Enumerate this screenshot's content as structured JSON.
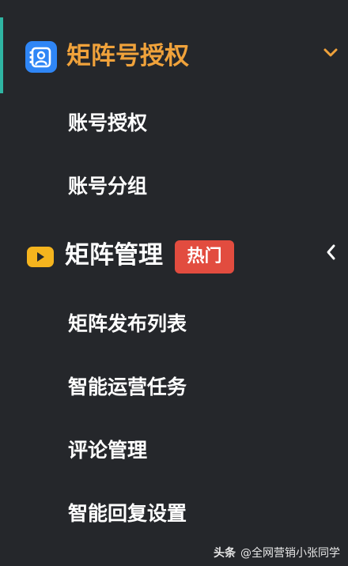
{
  "sidebar": {
    "sections": [
      {
        "title": "矩阵号授权",
        "icon": "user-card-icon",
        "expanded": true,
        "items": [
          {
            "label": "账号授权"
          },
          {
            "label": "账号分组"
          }
        ]
      },
      {
        "title": "矩阵管理",
        "icon": "video-icon",
        "badge": "热门",
        "expanded": false,
        "items": [
          {
            "label": "矩阵发布列表"
          },
          {
            "label": "智能运营任务"
          },
          {
            "label": "评论管理"
          },
          {
            "label": "智能回复设置"
          }
        ]
      }
    ]
  },
  "watermark": {
    "brand": "头条",
    "author": "@全网营销小张同学"
  },
  "colors": {
    "background": "#25272b",
    "active_indicator": "#2fb5a3",
    "active_title": "#f0a23b",
    "user_icon": "#2f86f6",
    "video_icon": "#f5b41e",
    "badge": "#e24c3f"
  }
}
